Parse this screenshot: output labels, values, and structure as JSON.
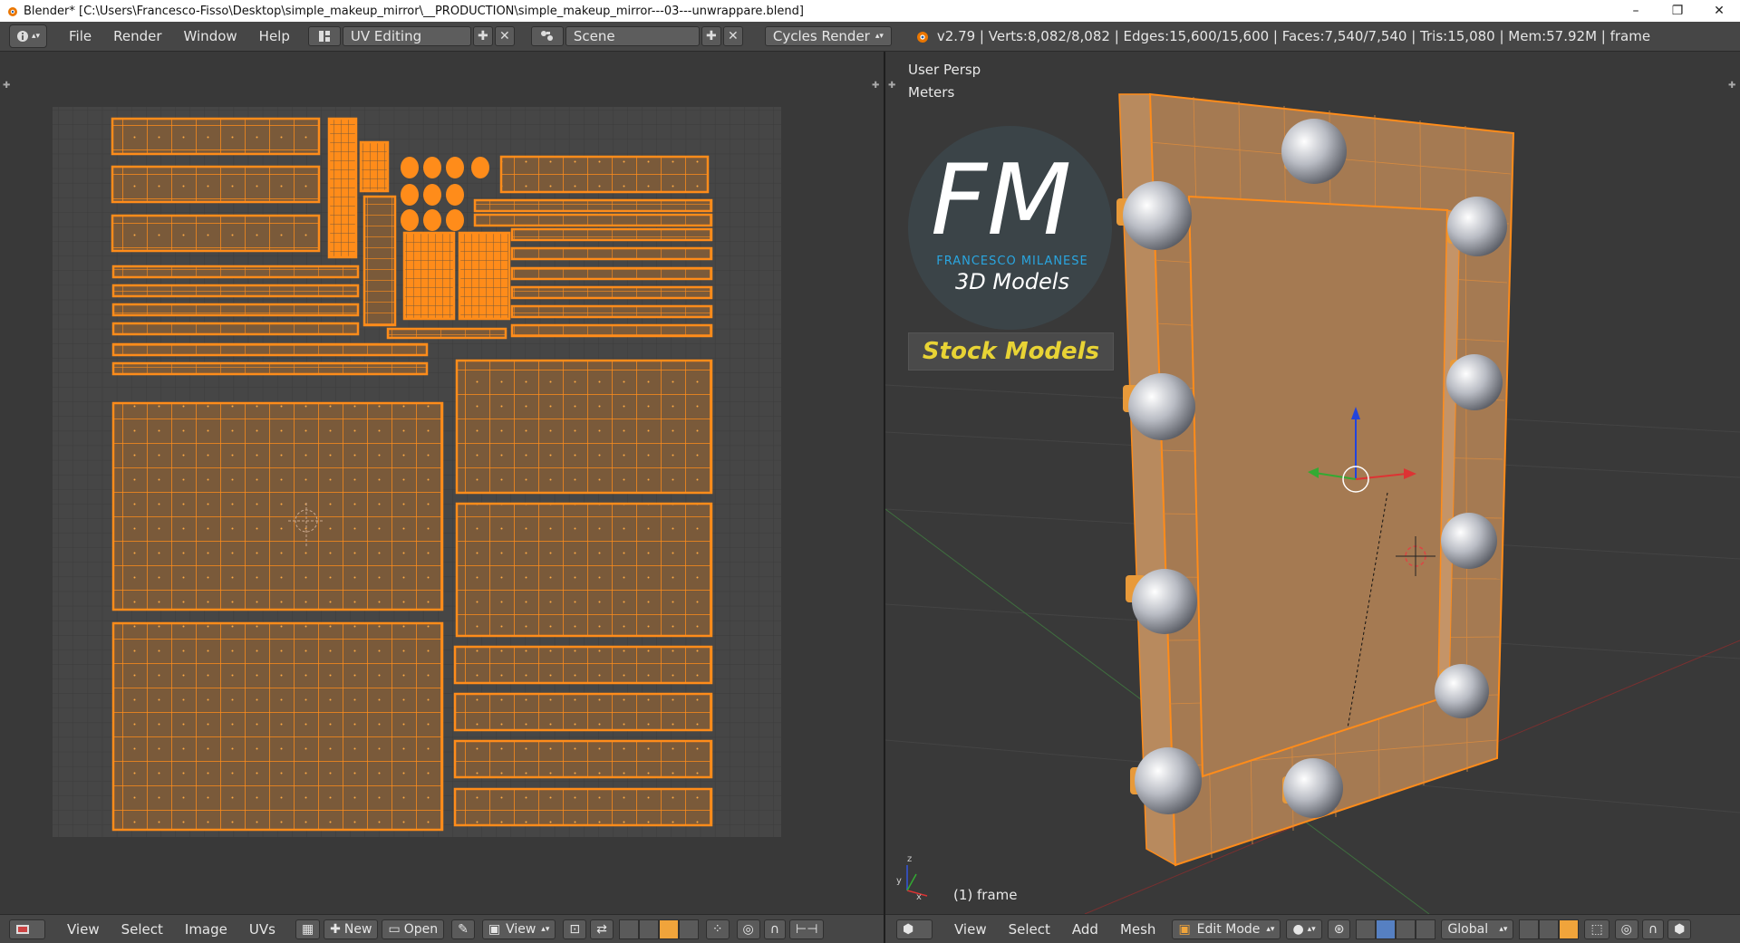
{
  "window": {
    "title": "Blender* [C:\\Users\\Francesco-Fisso\\Desktop\\simple_makeup_mirror\\__PRODUCTION\\simple_makeup_mirror---03---unwrappare.blend]",
    "controls": [
      "–",
      "❐",
      "✕"
    ]
  },
  "info_header": {
    "menus": [
      "File",
      "Render",
      "Window",
      "Help"
    ],
    "layout": "UV Editing",
    "scene": "Scene",
    "engine": "Cycles Render",
    "stats": "v2.79 | Verts:8,082/8,082 | Edges:15,600/15,600 | Faces:7,540/7,540 | Tris:15,080 | Mem:57.92M | frame"
  },
  "uv_editor": {
    "footer": {
      "menus": [
        "View",
        "Select",
        "Image",
        "UVs"
      ],
      "new_label": "New",
      "open_label": "Open",
      "view_label": "View"
    }
  },
  "viewport": {
    "view_name": "User Persp",
    "units": "Meters",
    "object_label": "(1) frame",
    "watermark": {
      "logo": "FM",
      "brand": "FRANCESCO MILANESE",
      "subtitle": "3D Models",
      "banner": "Stock Models"
    },
    "footer": {
      "menus": [
        "View",
        "Select",
        "Add",
        "Mesh"
      ],
      "mode": "Edit Mode",
      "orientation": "Global"
    }
  },
  "colors": {
    "accent": "#f0a43b",
    "uv_island_fill": "#7a5a3a",
    "uv_edge": "#ff8c1a",
    "background": "#393939",
    "header": "#464646",
    "logo_blue": "#2aa6e0",
    "banner_yellow": "#e8d335"
  }
}
